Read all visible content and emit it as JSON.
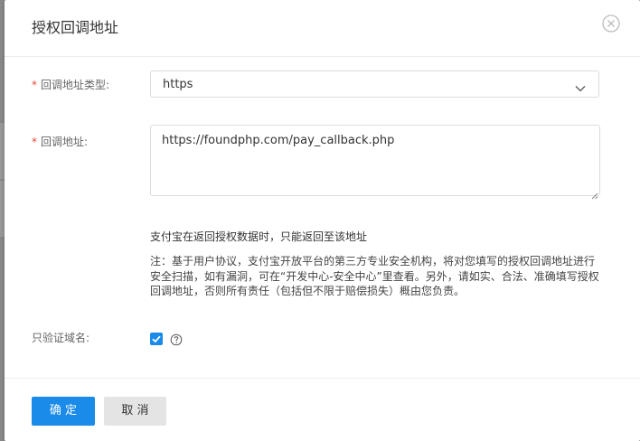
{
  "dialog": {
    "title": "授权回调地址",
    "close_icon": "close-circle-icon"
  },
  "form": {
    "callback_type": {
      "required_mark": "*",
      "label": "回调地址类型:",
      "value": "https",
      "icon": "chevron-down-icon"
    },
    "callback_url": {
      "required_mark": "*",
      "label": "回调地址:",
      "value": "https://foundphp.com/pay_callback.php"
    },
    "hint": "支付宝在返回授权数据时，只能返回至该地址",
    "note": "注：基于用户协议，支付宝开放平台的第三方专业安全机构，将对您填写的授权回调地址进行安全扫描，如有漏洞，可在“开发中心-安全中心”里查看。另外，请如实、合法、准确填写授权回调地址，否则所有责任（包括但不限于赔偿损失）概由您负责。",
    "domain_only": {
      "label": "只验证域名:",
      "checked": true,
      "help_icon": "question-circle-icon"
    }
  },
  "footer": {
    "confirm_label": "确 定",
    "cancel_label": "取 消"
  },
  "colors": {
    "primary": "#1a8be8",
    "required": "#e8463b",
    "cancel_bg": "#e4e4e4"
  }
}
